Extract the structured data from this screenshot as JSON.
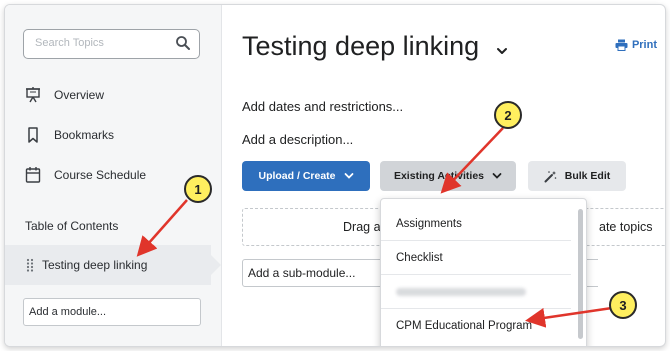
{
  "sidebar": {
    "search_placeholder": "Search Topics",
    "nav": [
      {
        "label": "Overview",
        "icon": "presentation-icon"
      },
      {
        "label": "Bookmarks",
        "icon": "bookmark-icon"
      },
      {
        "label": "Course Schedule",
        "icon": "calendar-icon"
      }
    ],
    "toc_label": "Table of Contents",
    "toc_item": "Testing deep linking",
    "add_module": "Add a module..."
  },
  "main": {
    "title": "Testing deep linking",
    "print_label": "Print",
    "add_dates": "Add dates and restrictions...",
    "add_description": "Add a description...",
    "upload_create": "Upload / Create",
    "existing_activities": "Existing Activities",
    "bulk_edit": "Bulk Edit",
    "drag_text_left": "Drag a",
    "drag_text_right": "ate topics",
    "add_sub_module": "Add a sub-module..."
  },
  "dropdown": {
    "items": [
      "Assignments",
      "Checklist",
      "",
      "CPM Educational Program"
    ]
  },
  "callouts": [
    "1",
    "2",
    "3"
  ],
  "colors": {
    "accent": "#2e6fbd",
    "arrow": "#e0352b",
    "callout": "#ffef5f"
  }
}
